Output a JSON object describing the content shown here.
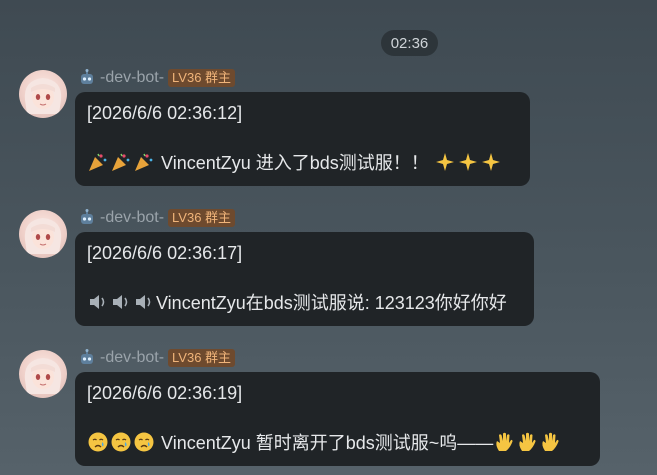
{
  "time_divider": "02:36",
  "messages": [
    {
      "sender": "-dev-bot-",
      "badge": "LV36 群主",
      "timestamp": "[2026/6/6 02:36:12]",
      "body": "VincentZyu 进入了bds测试服！！",
      "emoji_left": "party-popper",
      "emoji_right": "sparkles"
    },
    {
      "sender": "-dev-bot-",
      "badge": "LV36 群主",
      "timestamp": "[2026/6/6 02:36:17]",
      "body": "VincentZyu在bds测试服说: 123123你好你好",
      "emoji_left": "speaker"
    },
    {
      "sender": "-dev-bot-",
      "badge": "LV36 群主",
      "timestamp": "[2026/6/6 02:36:19]",
      "body": "VincentZyu 暂时离开了bds测试服~呜——",
      "emoji_left": "crying-face",
      "emoji_right": "waving-hand"
    }
  ],
  "colors": {
    "bubble": "#202427",
    "badge_bg": "#6e4a2e",
    "badge_text": "#f0b47a",
    "sender_text": "#9aa3aa"
  }
}
